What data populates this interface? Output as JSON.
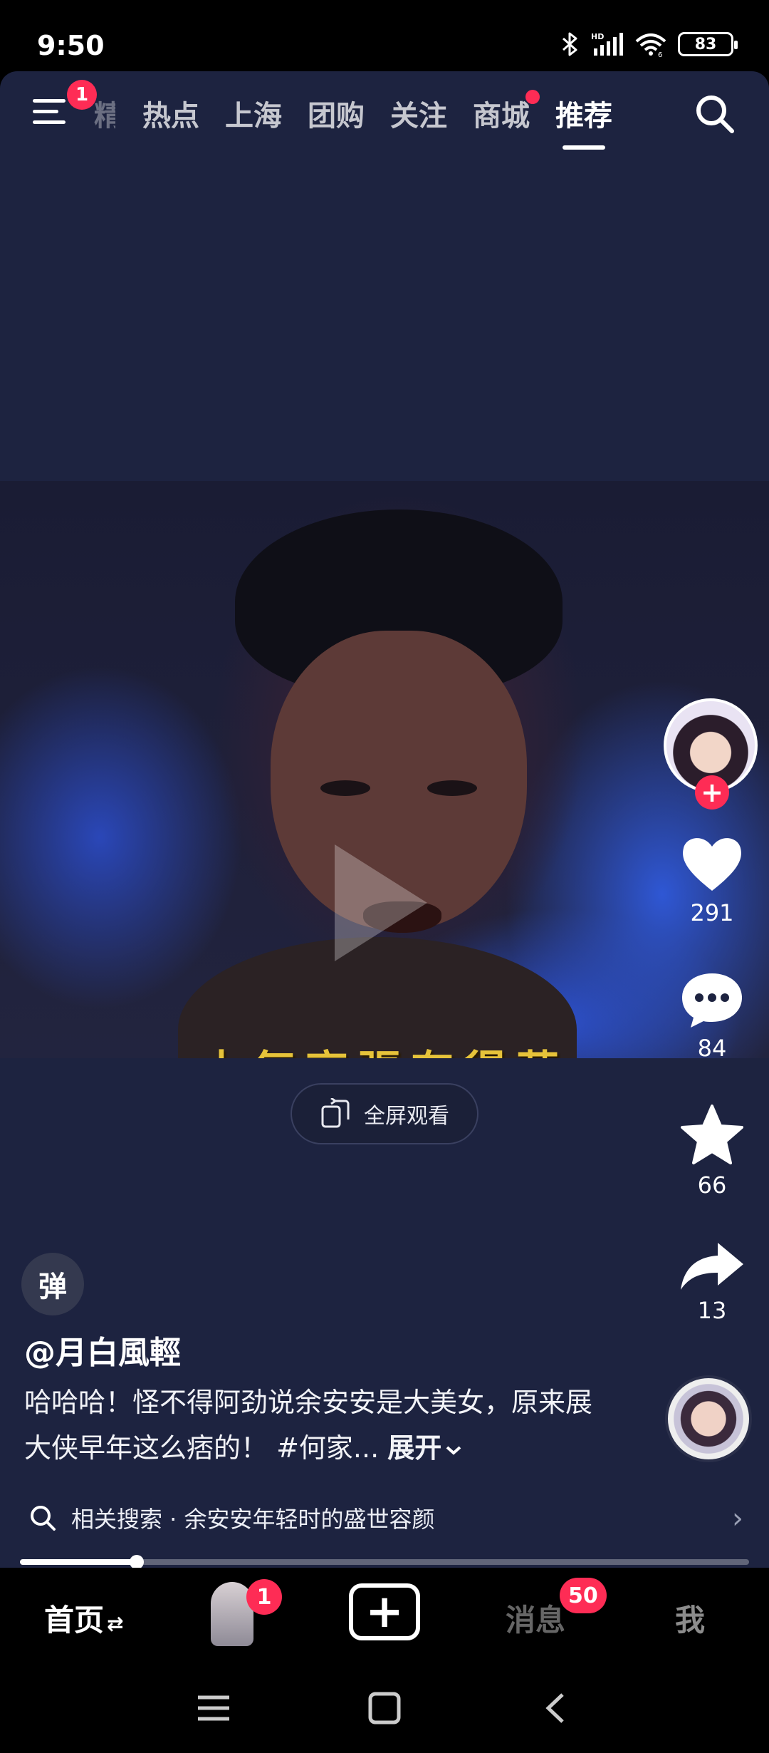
{
  "status_bar": {
    "time": "9:50",
    "battery": "83",
    "icons": [
      "bluetooth-icon",
      "hd-signal-icon",
      "wifi-icon",
      "battery-icon"
    ]
  },
  "top_nav": {
    "menu_badge": "1",
    "tabs": [
      {
        "label": "精选",
        "state": "partial"
      },
      {
        "label": "热点"
      },
      {
        "label": "上海"
      },
      {
        "label": "团购"
      },
      {
        "label": "关注"
      },
      {
        "label": "商城",
        "dot": true
      },
      {
        "label": "推荐",
        "active": true
      }
    ]
  },
  "video": {
    "subtitle": "士氣高張有得蒔"
  },
  "fullscreen_label": "全屏观看",
  "rail": {
    "likes": "291",
    "comments": "84",
    "favorites": "66",
    "shares": "13"
  },
  "post": {
    "danmu_label": "弹",
    "author": "@月白風輕",
    "description": "哈哈哈！怪不得阿劲说余安安是大美女，原来展大侠早年这么痞的！ #何家...",
    "expand_label": "展开",
    "related_search": "相关搜索 · 余安安年轻时的盛世容颜",
    "progress": 0.16
  },
  "bottom_nav": {
    "home": "首页",
    "friend_badge": "1",
    "messages": "消息",
    "messages_badge": "50",
    "me": "我"
  },
  "colors": {
    "background": "#1d2340",
    "accent": "#fe2c55",
    "subtitle": "#e6c33a"
  }
}
